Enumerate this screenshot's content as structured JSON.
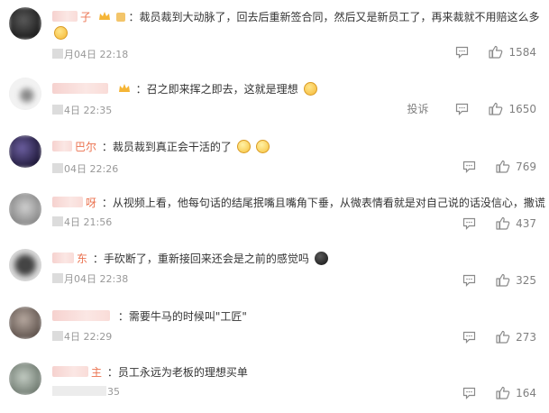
{
  "comments": [
    {
      "name_suffix": "子",
      "text": "：裁员裁到大动脉了，回去后重新签合同，然后又是新员工了，再来裁就不用赔这么多",
      "time": "月04日 22:18",
      "likes": "1584",
      "avatar_color": "#2a2a2a",
      "emojis": [
        "face"
      ]
    },
    {
      "name_suffix": "",
      "text": "：召之即来挥之即去，这就是理想",
      "time": "4日 22:35",
      "likes": "1650",
      "report": "投诉",
      "avatar_color": "#e9e9e9",
      "emojis": [
        "face"
      ]
    },
    {
      "name_suffix": "巴尔",
      "text": "：裁员裁到真正会干活的了",
      "time": "04日 22:26",
      "likes": "769",
      "avatar_color": "#3a2f5a",
      "emojis": [
        "cry",
        "cry"
      ]
    },
    {
      "name_suffix": "呀",
      "text": "：从视频上看，他每句话的结尾抿嘴且嘴角下垂，从微表情看就是对自己说的话没信心，撒谎",
      "time": "4日 21:56",
      "likes": "437",
      "avatar_color": "#b9b9b9",
      "emojis": []
    },
    {
      "name_suffix": "东",
      "text": "：手砍断了，重新接回来还会是之前的感觉吗",
      "time": "月04日 22:38",
      "likes": "325",
      "avatar_color": "#1b1b1b",
      "emojis": [
        "dark"
      ]
    },
    {
      "name_suffix": "",
      "text": "：需要牛马的时候叫\"工匠\"",
      "time": "4日 22:29",
      "likes": "273",
      "avatar_color": "#8c7f7a",
      "emojis": []
    },
    {
      "name_suffix": "主",
      "text": "：员工永远为老板的理想买单",
      "time": "35",
      "likes": "164",
      "avatar_color": "#9aa59a",
      "emojis": []
    }
  ],
  "colors": {
    "name": "#eb7350",
    "text": "#333333",
    "meta": "#999999",
    "action": "#808080"
  },
  "icons": {
    "comment": "comment-icon",
    "like": "thumbs-up-icon",
    "badge": "crown-badge-icon"
  }
}
